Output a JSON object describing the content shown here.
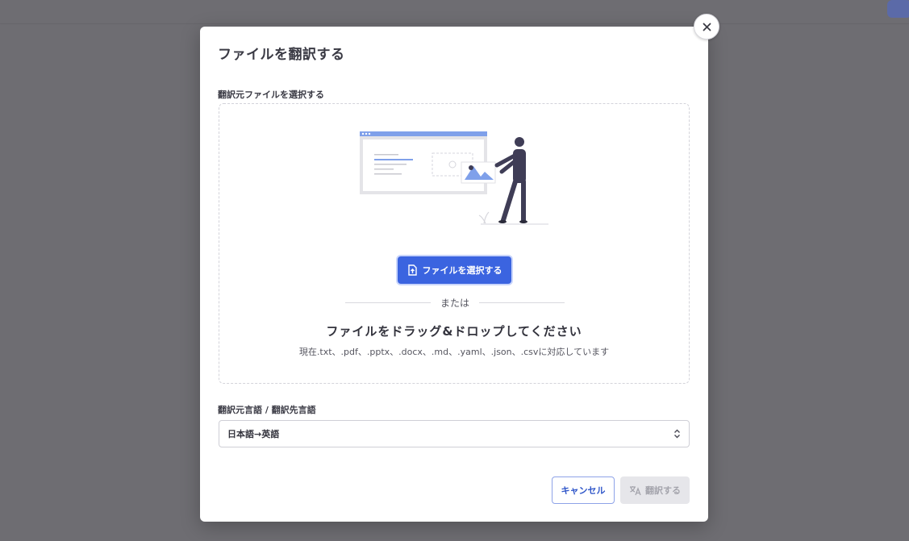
{
  "dialog": {
    "title": "ファイルを翻訳する",
    "close_icon": "close-icon"
  },
  "file_section": {
    "label": "翻訳元ファイルを選択する",
    "select_button_label": "ファイルを選択する",
    "select_button_icon": "file-upload-icon",
    "or_text": "または",
    "drag_text": "ファイルをドラッグ&ドロップしてください",
    "supported_text": "現在.txt、.pdf、.pptx、.docx、.md、.yaml、.json、.csvに対応しています"
  },
  "language_section": {
    "label": "翻訳元言語 / 翻訳先言語",
    "selected_value": "日本語→英語",
    "select_icon": "chevron-updown-icon"
  },
  "footer": {
    "cancel_label": "キャンセル",
    "translate_label": "翻訳する",
    "translate_icon": "translate-icon"
  },
  "colors": {
    "primary": "#3b64e0",
    "backdrop": "#6e6d72",
    "disabled_bg": "#e6e6ea"
  }
}
